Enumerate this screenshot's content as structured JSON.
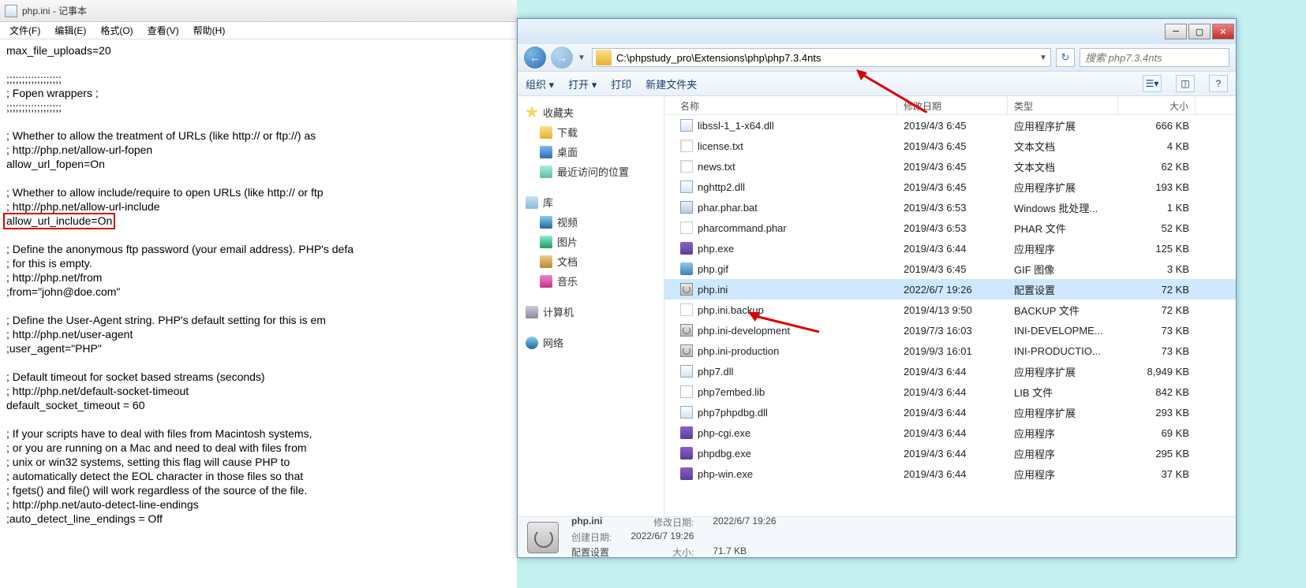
{
  "notepad": {
    "title": "php.ini - 记事本",
    "menu": [
      "文件(F)",
      "编辑(E)",
      "格式(O)",
      "查看(V)",
      "帮助(H)"
    ],
    "lines_before_highlight": "max_file_uploads=20\n\n;;;;;;;;;;;;;;;;;;\n; Fopen wrappers ;\n;;;;;;;;;;;;;;;;;;\n\n; Whether to allow the treatment of URLs (like http:// or ftp://) as\n; http://php.net/allow-url-fopen\nallow_url_fopen=On\n\n; Whether to allow include/require to open URLs (like http:// or ftp\n; http://php.net/allow-url-include\n",
    "highlight_text": "allow_url_include=On",
    "lines_after_highlight": "\n\n; Define the anonymous ftp password (your email address). PHP's defa\n; for this is empty.\n; http://php.net/from\n;from=\"john@doe.com\"\n\n; Define the User-Agent string. PHP's default setting for this is em\n; http://php.net/user-agent\n;user_agent=\"PHP\"\n\n; Default timeout for socket based streams (seconds)\n; http://php.net/default-socket-timeout\ndefault_socket_timeout = 60\n\n; If your scripts have to deal with files from Macintosh systems,\n; or you are running on a Mac and need to deal with files from\n; unix or win32 systems, setting this flag will cause PHP to\n; automatically detect the EOL character in those files so that\n; fgets() and file() will work regardless of the source of the file.\n; http://php.net/auto-detect-line-endings\n;auto_detect_line_endings = Off"
  },
  "explorer": {
    "address": "C:\\phpstudy_pro\\Extensions\\php\\php7.3.4nts",
    "search_placeholder": "搜索 php7.3.4nts",
    "toolbar": {
      "organize": "组织 ▾",
      "open": "打开 ▾",
      "print": "打印",
      "newfolder": "新建文件夹"
    },
    "sidebar": {
      "favorites": {
        "head": "收藏夹",
        "items": [
          "下载",
          "桌面",
          "最近访问的位置"
        ]
      },
      "library": {
        "head": "库",
        "items": [
          "视频",
          "图片",
          "文档",
          "音乐"
        ]
      },
      "computer": "计算机",
      "network": "网络"
    },
    "columns": {
      "name": "名称",
      "date": "修改日期",
      "type": "类型",
      "size": "大小"
    },
    "files": [
      {
        "icon": "fi-dll",
        "name": "libssl-1_1-x64.dll",
        "date": "2019/4/3 6:45",
        "type": "应用程序扩展",
        "size": "666 KB",
        "sel": false
      },
      {
        "icon": "fi-txt",
        "name": "license.txt",
        "date": "2019/4/3 6:45",
        "type": "文本文档",
        "size": "4 KB",
        "sel": false
      },
      {
        "icon": "fi-txt",
        "name": "news.txt",
        "date": "2019/4/3 6:45",
        "type": "文本文档",
        "size": "62 KB",
        "sel": false
      },
      {
        "icon": "fi-dll",
        "name": "nghttp2.dll",
        "date": "2019/4/3 6:45",
        "type": "应用程序扩展",
        "size": "193 KB",
        "sel": false
      },
      {
        "icon": "fi-bat",
        "name": "phar.phar.bat",
        "date": "2019/4/3 6:53",
        "type": "Windows 批处理...",
        "size": "1 KB",
        "sel": false
      },
      {
        "icon": "fi-phar",
        "name": "pharcommand.phar",
        "date": "2019/4/3 6:53",
        "type": "PHAR 文件",
        "size": "52 KB",
        "sel": false
      },
      {
        "icon": "fi-exe",
        "name": "php.exe",
        "date": "2019/4/3 6:44",
        "type": "应用程序",
        "size": "125 KB",
        "sel": false
      },
      {
        "icon": "fi-gif",
        "name": "php.gif",
        "date": "2019/4/3 6:45",
        "type": "GIF 图像",
        "size": "3 KB",
        "sel": false
      },
      {
        "icon": "fi-ini",
        "name": "php.ini",
        "date": "2022/6/7 19:26",
        "type": "配置设置",
        "size": "72 KB",
        "sel": true
      },
      {
        "icon": "fi-bak",
        "name": "php.ini.backup",
        "date": "2019/4/13 9:50",
        "type": "BACKUP 文件",
        "size": "72 KB",
        "sel": false
      },
      {
        "icon": "fi-ini",
        "name": "php.ini-development",
        "date": "2019/7/3 16:03",
        "type": "INI-DEVELOPME...",
        "size": "73 KB",
        "sel": false
      },
      {
        "icon": "fi-ini",
        "name": "php.ini-production",
        "date": "2019/9/3 16:01",
        "type": "INI-PRODUCTIO...",
        "size": "73 KB",
        "sel": false
      },
      {
        "icon": "fi-dll",
        "name": "php7.dll",
        "date": "2019/4/3 6:44",
        "type": "应用程序扩展",
        "size": "8,949 KB",
        "sel": false
      },
      {
        "icon": "fi-lib",
        "name": "php7embed.lib",
        "date": "2019/4/3 6:44",
        "type": "LIB 文件",
        "size": "842 KB",
        "sel": false
      },
      {
        "icon": "fi-dll",
        "name": "php7phpdbg.dll",
        "date": "2019/4/3 6:44",
        "type": "应用程序扩展",
        "size": "293 KB",
        "sel": false
      },
      {
        "icon": "fi-exe",
        "name": "php-cgi.exe",
        "date": "2019/4/3 6:44",
        "type": "应用程序",
        "size": "69 KB",
        "sel": false
      },
      {
        "icon": "fi-exe",
        "name": "phpdbg.exe",
        "date": "2019/4/3 6:44",
        "type": "应用程序",
        "size": "295 KB",
        "sel": false
      },
      {
        "icon": "fi-exe",
        "name": "php-win.exe",
        "date": "2019/4/3 6:44",
        "type": "应用程序",
        "size": "37 KB",
        "sel": false
      }
    ],
    "status": {
      "filename": "php.ini",
      "mod_label": "修改日期:",
      "mod_value": "2022/6/7 19:26",
      "create_label": "创建日期:",
      "create_value": "2022/6/7 19:26",
      "type_value": "配置设置",
      "size_label": "大小:",
      "size_value": "71.7 KB"
    }
  }
}
